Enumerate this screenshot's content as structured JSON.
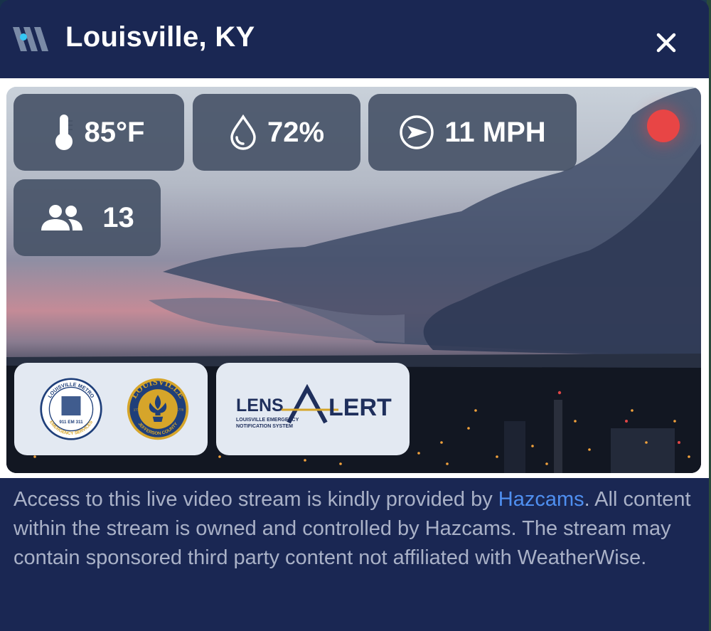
{
  "window": {
    "title": "Louisville, KY"
  },
  "icons": {
    "brand": "weatherwise-logo",
    "close": "close-icon",
    "temperature": "thermometer-icon",
    "humidity": "droplet-icon",
    "wind": "wind-direction-icon",
    "viewers": "people-icon"
  },
  "stats": {
    "temperature": "85°F",
    "humidity": "72%",
    "wind": "11 MPH",
    "viewers": "13"
  },
  "live_indicator": {
    "color": "#e84545"
  },
  "sponsors": {
    "metro_seal_text_top": "LOUISVILLE METRO",
    "metro_seal_text_bottom": "EMERGENCY SERVICES",
    "metro_seal_center": "911 EM 311",
    "county_seal_text_top": "LOUISVILLE",
    "county_seal_text_bottom": "JEFFERSON COUNTY",
    "county_seal_year_left": "1778",
    "county_seal_year_right": "1778",
    "lensalert_logo_a": "LENS",
    "lensalert_logo_b": "LERT",
    "lensalert_tagline_1": "LOUISVILLE EMERGENCY",
    "lensalert_tagline_2": "NOTIFICATION SYSTEM"
  },
  "footer": {
    "text_before_link": "Access to this live video stream is kindly provided by ",
    "link_text": "Hazcams",
    "text_after_link": ". All content within the stream is owned and controlled by Hazcams. The stream may contain sponsored third party content not affiliated with WeatherWise."
  },
  "colors": {
    "header_bg": "#1a2753",
    "chip_bg": "#485468",
    "link": "#4f8ff0",
    "footer_text": "#a9b1c7",
    "seal_blue": "#1f3f7a",
    "seal_gold": "#d6a52a"
  }
}
